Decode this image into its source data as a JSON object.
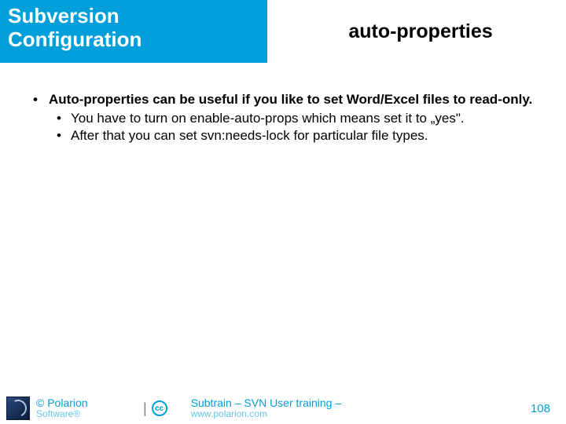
{
  "header": {
    "left_line1": "Subversion",
    "left_line2": "Configuration",
    "right": "auto-properties"
  },
  "bullets": {
    "main": "Auto-properties can be useful if you like to set Word/Excel files to read-only.",
    "sub1": "You have to turn on enable-auto-props which means set it to „yes\".",
    "sub2": "After that you can set svn:needs-lock for particular file types."
  },
  "footer": {
    "copyright_line1": "© Polarion",
    "copyright_line2": "Software®",
    "cc": "cc",
    "center_line1": "Subtrain – SVN User training –",
    "center_line2": "www.polarion.com",
    "page": "108"
  }
}
